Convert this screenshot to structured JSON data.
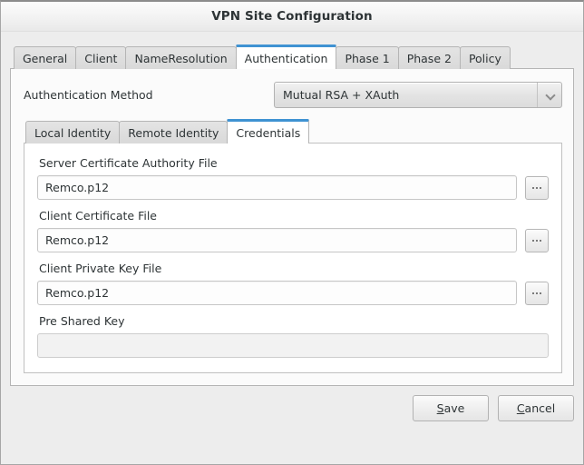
{
  "window": {
    "title": "VPN Site Configuration"
  },
  "tabs": [
    {
      "label": "General",
      "active": false
    },
    {
      "label": "Client",
      "active": false
    },
    {
      "label": "NameResolution",
      "active": false
    },
    {
      "label": "Authentication",
      "active": true
    },
    {
      "label": "Phase 1",
      "active": false
    },
    {
      "label": "Phase 2",
      "active": false
    },
    {
      "label": "Policy",
      "active": false
    }
  ],
  "auth_method": {
    "label": "Authentication Method",
    "value": "Mutual RSA + XAuth",
    "arrow_icon": "chevron-down-icon"
  },
  "inner_tabs": [
    {
      "label": "Local Identity",
      "active": false
    },
    {
      "label": "Remote Identity",
      "active": false
    },
    {
      "label": "Credentials",
      "active": true
    }
  ],
  "fields": [
    {
      "label": "Server Certificate Authority File",
      "value": "Remco.p12",
      "placeholder": "",
      "has_browse": true,
      "browse_label": "...",
      "disabled": false
    },
    {
      "label": "Client Certificate File",
      "value": "Remco.p12",
      "placeholder": "",
      "has_browse": true,
      "browse_label": "...",
      "disabled": false
    },
    {
      "label": "Client Private Key File",
      "value": "Remco.p12",
      "placeholder": "",
      "has_browse": true,
      "browse_label": "...",
      "disabled": false
    },
    {
      "label": "Pre Shared Key",
      "value": "",
      "placeholder": "",
      "has_browse": false,
      "browse_label": "",
      "disabled": true
    }
  ],
  "footer": {
    "save": {
      "mnemonic": "S",
      "rest": "ave"
    },
    "cancel": {
      "mnemonic": "C",
      "rest": "ancel"
    }
  },
  "colors": {
    "accent": "#3f92d2",
    "window_bg": "#ededed",
    "panel_bg": "#ffffff",
    "text": "#2e3436"
  }
}
